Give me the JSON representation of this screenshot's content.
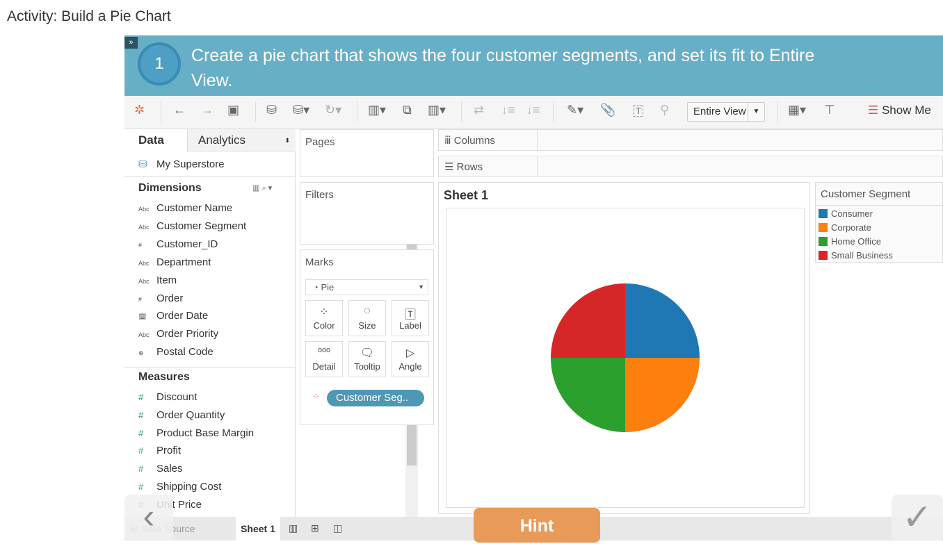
{
  "page_title": "Activity: Build a Pie Chart",
  "instruction": {
    "step": "1",
    "text": "Create a pie chart that shows the four customer segments, and set its fit to Entire View.",
    "collapse_icon": "double-chevron-right"
  },
  "toolbar": {
    "fit": "Entire View",
    "show_me": "Show Me"
  },
  "data_pane": {
    "tab_data": "Data",
    "tab_analytics": "Analytics",
    "source": "My Superstore",
    "dimensions_label": "Dimensions",
    "dimensions": [
      {
        "type": "Abc",
        "name": "Customer Name"
      },
      {
        "type": "Abc",
        "name": "Customer Segment"
      },
      {
        "type": "#",
        "name": "Customer_ID"
      },
      {
        "type": "Abc",
        "name": "Department"
      },
      {
        "type": "Abc",
        "name": "Item"
      },
      {
        "type": "#",
        "name": "Order"
      },
      {
        "type": "date",
        "name": "Order Date"
      },
      {
        "type": "Abc",
        "name": "Order Priority"
      },
      {
        "type": "geo",
        "name": "Postal Code"
      }
    ],
    "measures_label": "Measures",
    "measures": [
      "Discount",
      "Order Quantity",
      "Product Base Margin",
      "Profit",
      "Sales",
      "Shipping Cost",
      "Unit Price"
    ]
  },
  "shelves": {
    "pages": "Pages",
    "filters": "Filters",
    "columns": "Columns",
    "rows": "Rows"
  },
  "marks": {
    "label": "Marks",
    "type": "Pie",
    "cards": [
      "Color",
      "Size",
      "Label",
      "Detail",
      "Tooltip",
      "Angle"
    ],
    "pill": "Customer Seg.."
  },
  "sheet": {
    "title": "Sheet 1"
  },
  "legend": {
    "title": "Customer Segment",
    "items": [
      {
        "name": "Consumer",
        "color": "#1f77b4"
      },
      {
        "name": "Corporate",
        "color": "#ff7f0e"
      },
      {
        "name": "Home Office",
        "color": "#2ca02c"
      },
      {
        "name": "Small Business",
        "color": "#d62728"
      }
    ]
  },
  "chart_data": {
    "type": "pie",
    "categories": [
      "Consumer",
      "Corporate",
      "Home Office",
      "Small Business"
    ],
    "values": [
      25,
      25,
      25,
      25
    ],
    "colors": [
      "#1f77b4",
      "#ff7f0e",
      "#2ca02c",
      "#d62728"
    ]
  },
  "bottom": {
    "data_source": "Data Source",
    "sheet_tab": "Sheet 1"
  },
  "hint": "Hint"
}
